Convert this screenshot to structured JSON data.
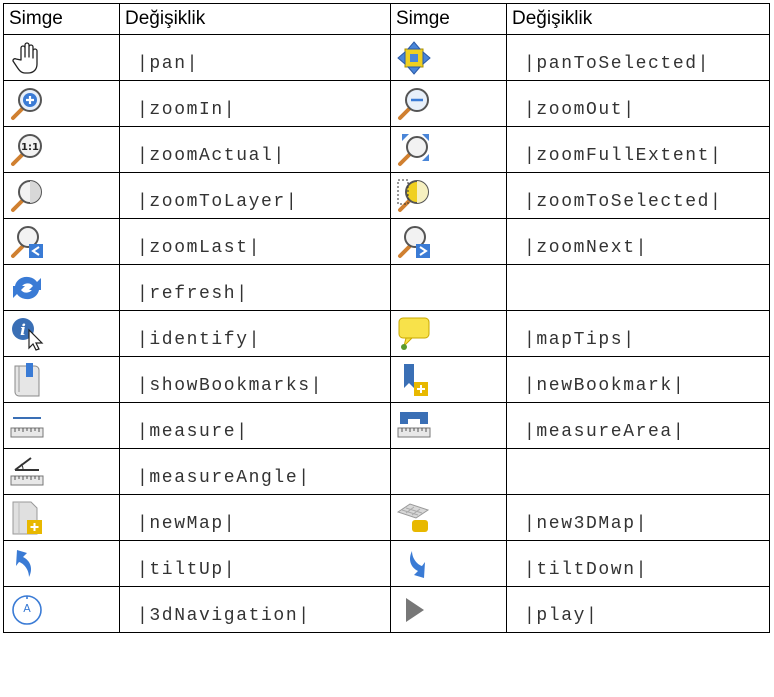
{
  "header": {
    "icon_col_1": "Simge",
    "change_col_1": "Değişiklik",
    "icon_col_2": "Simge",
    "change_col_2": "Değişiklik"
  },
  "rows": [
    {
      "left": {
        "icon": "pan-hand-icon",
        "text": "|pan|"
      },
      "right": {
        "icon": "pan-to-selected-icon",
        "text": "|panToSelected|"
      }
    },
    {
      "left": {
        "icon": "zoom-in-icon",
        "text": "|zoomIn|"
      },
      "right": {
        "icon": "zoom-out-icon",
        "text": "|zoomOut|"
      }
    },
    {
      "left": {
        "icon": "zoom-actual-icon",
        "text": "|zoomActual|"
      },
      "right": {
        "icon": "zoom-full-extent-icon",
        "text": "|zoomFullExtent|"
      }
    },
    {
      "left": {
        "icon": "zoom-to-layer-icon",
        "text": "|zoomToLayer|"
      },
      "right": {
        "icon": "zoom-to-selected-icon",
        "text": "|zoomToSelected|"
      }
    },
    {
      "left": {
        "icon": "zoom-last-icon",
        "text": "|zoomLast|"
      },
      "right": {
        "icon": "zoom-next-icon",
        "text": "|zoomNext|"
      }
    },
    {
      "left": {
        "icon": "refresh-icon",
        "text": "|refresh|"
      },
      "right": null
    },
    {
      "left": {
        "icon": "identify-icon",
        "text": "|identify|"
      },
      "right": {
        "icon": "map-tips-icon",
        "text": "|mapTips|"
      }
    },
    {
      "left": {
        "icon": "show-bookmarks-icon",
        "text": "|showBookmarks|"
      },
      "right": {
        "icon": "new-bookmark-icon",
        "text": "|newBookmark|"
      }
    },
    {
      "left": {
        "icon": "measure-icon",
        "text": "|measure|"
      },
      "right": {
        "icon": "measure-area-icon",
        "text": "|measureArea|"
      }
    },
    {
      "left": {
        "icon": "measure-angle-icon",
        "text": "|measureAngle|"
      },
      "right": null
    },
    {
      "left": {
        "icon": "new-map-icon",
        "text": "|newMap|"
      },
      "right": {
        "icon": "new-3d-map-icon",
        "text": "|new3DMap|"
      }
    },
    {
      "left": {
        "icon": "tilt-up-icon",
        "text": "|tiltUp|"
      },
      "right": {
        "icon": "tilt-down-icon",
        "text": "|tiltDown|"
      }
    },
    {
      "left": {
        "icon": "3d-navigation-icon",
        "text": "|3dNavigation|"
      },
      "right": {
        "icon": "play-icon",
        "text": "|play|"
      }
    }
  ]
}
